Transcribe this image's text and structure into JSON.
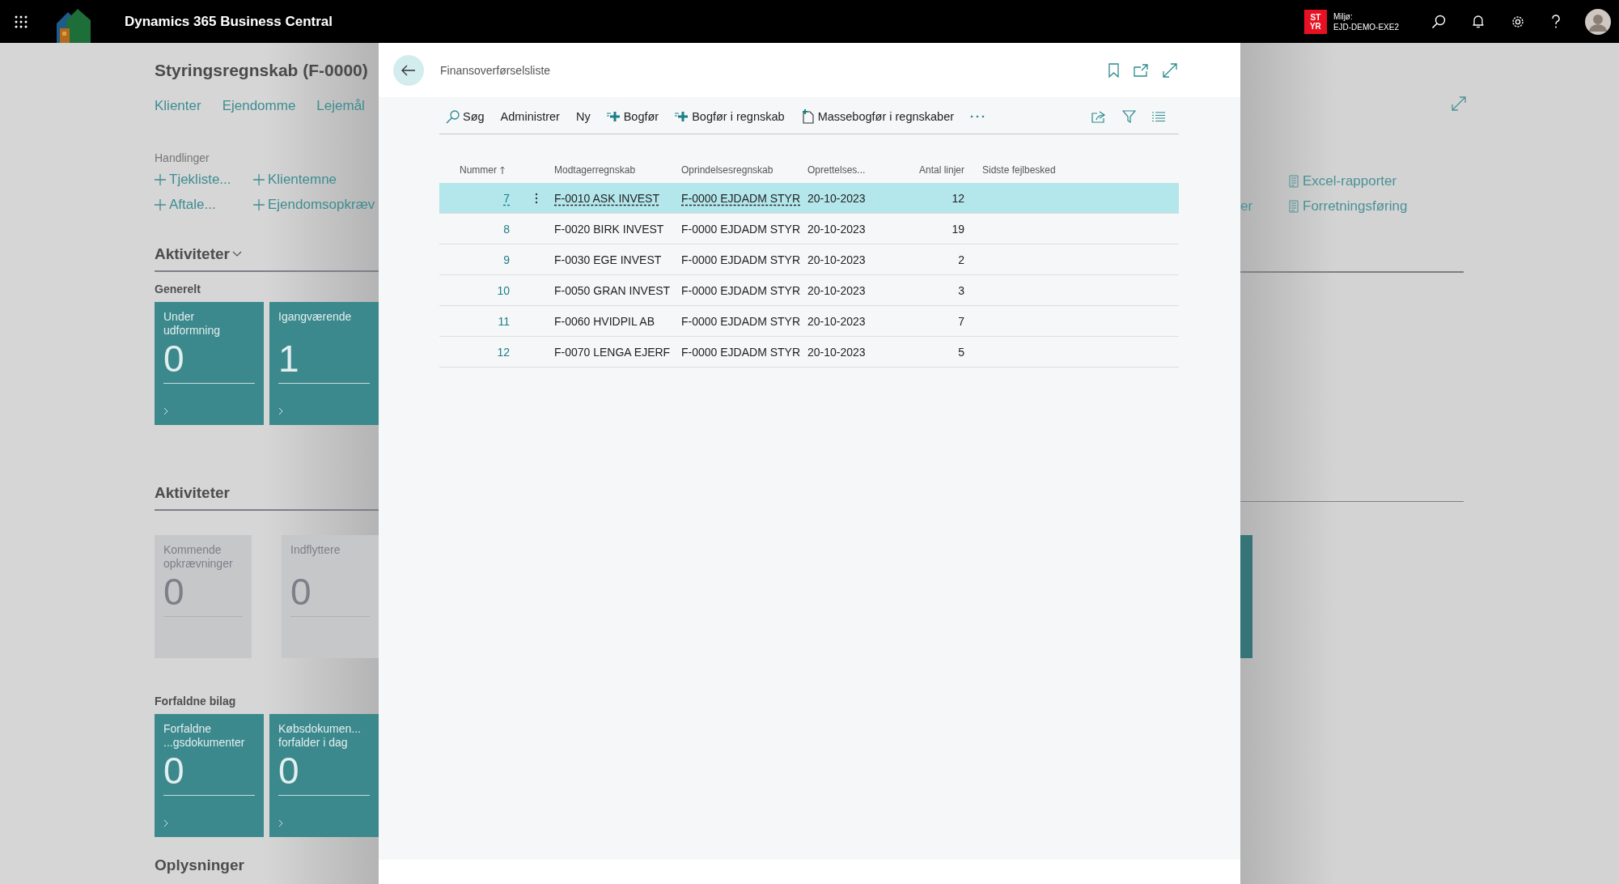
{
  "app_bar": {
    "title": "Dynamics 365 Business Central",
    "badge_lines": [
      "ST",
      "YR"
    ],
    "environment_label": "Miljø:",
    "environment_name": "EJD-DEMO-EXE2"
  },
  "background_page": {
    "title": "Styringsregnskab (F-0000)",
    "nav_links": [
      "Klienter",
      "Ejendomme",
      "Lejemål"
    ],
    "actions_heading": "Handlinger",
    "actions": [
      {
        "label": "Tjekliste..."
      },
      {
        "label": "Klientemne"
      },
      {
        "label": "Aftale..."
      },
      {
        "label": "Ejendomsopkræv"
      }
    ],
    "cut_text": "er",
    "reports": [
      {
        "label": "Excel-rapporter"
      },
      {
        "label": "Forretningsføring"
      }
    ],
    "sections": [
      {
        "title": "Aktiviteter",
        "collapsible": true,
        "groups": [
          {
            "heading": "Generelt",
            "tiles": [
              {
                "kind": "active",
                "label_lines": [
                  "Under",
                  "udformning"
                ],
                "value": "0"
              },
              {
                "kind": "active",
                "label_lines": [
                  "Igangværende"
                ],
                "value": "1"
              }
            ]
          }
        ]
      },
      {
        "title": "Aktiviteter",
        "collapsible": false,
        "groups": [
          {
            "tiles": [
              {
                "kind": "inactive",
                "label_lines": [
                  "Kommende",
                  "opkrævninger"
                ],
                "value": "0"
              },
              {
                "kind": "inactive",
                "label_lines": [
                  "Indflyttere"
                ],
                "value": "0"
              }
            ]
          },
          {
            "heading": "Forfaldne bilag",
            "tiles": [
              {
                "kind": "active",
                "label_lines": [
                  "Forfaldne",
                  "...gsdokumenter"
                ],
                "value": "0"
              },
              {
                "kind": "active",
                "label_lines": [
                  "Købsdokumen...",
                  "forfalder i dag"
                ],
                "value": "0"
              }
            ]
          }
        ]
      },
      {
        "title": "Oplysninger",
        "collapsible": false
      }
    ]
  },
  "dialog": {
    "title": "Finansoverførselsliste",
    "actions": [
      {
        "kind": "search",
        "label": "Søg"
      },
      {
        "kind": "plain",
        "label": "Administrer"
      },
      {
        "kind": "plain",
        "label": "Ny"
      },
      {
        "kind": "post",
        "label": "Bogfør"
      },
      {
        "kind": "post",
        "label": "Bogfør i regnskab"
      },
      {
        "kind": "mass",
        "label": "Massebogfør i regnskaber"
      }
    ],
    "columns": [
      "Nummer",
      "Modtagerregnskab",
      "Oprindelsesregnskab",
      "Oprettelses...",
      "Antal linjer",
      "Sidste fejlbesked"
    ],
    "rows": [
      {
        "number": "7",
        "recipient": "F-0010 ASK INVEST",
        "origin": "F-0000 EJDADM STYR",
        "date": "20-10-2023",
        "lines": "12",
        "selected": true
      },
      {
        "number": "8",
        "recipient": "F-0020 BIRK INVEST",
        "origin": "F-0000 EJDADM STYR",
        "date": "20-10-2023",
        "lines": "19",
        "selected": false
      },
      {
        "number": "9",
        "recipient": "F-0030 EGE INVEST",
        "origin": "F-0000 EJDADM STYR",
        "date": "20-10-2023",
        "lines": "2",
        "selected": false
      },
      {
        "number": "10",
        "recipient": "F-0050 GRAN INVEST",
        "origin": "F-0000 EJDADM STYR",
        "date": "20-10-2023",
        "lines": "3",
        "selected": false
      },
      {
        "number": "11",
        "recipient": "F-0060 HVIDPIL AB",
        "origin": "F-0000 EJDADM STYR",
        "date": "20-10-2023",
        "lines": "7",
        "selected": false
      },
      {
        "number": "12",
        "recipient": "F-0070 LENGA EJERF",
        "origin": "F-0000 EJDADM STYR",
        "date": "20-10-2023",
        "lines": "5",
        "selected": false
      }
    ]
  }
}
